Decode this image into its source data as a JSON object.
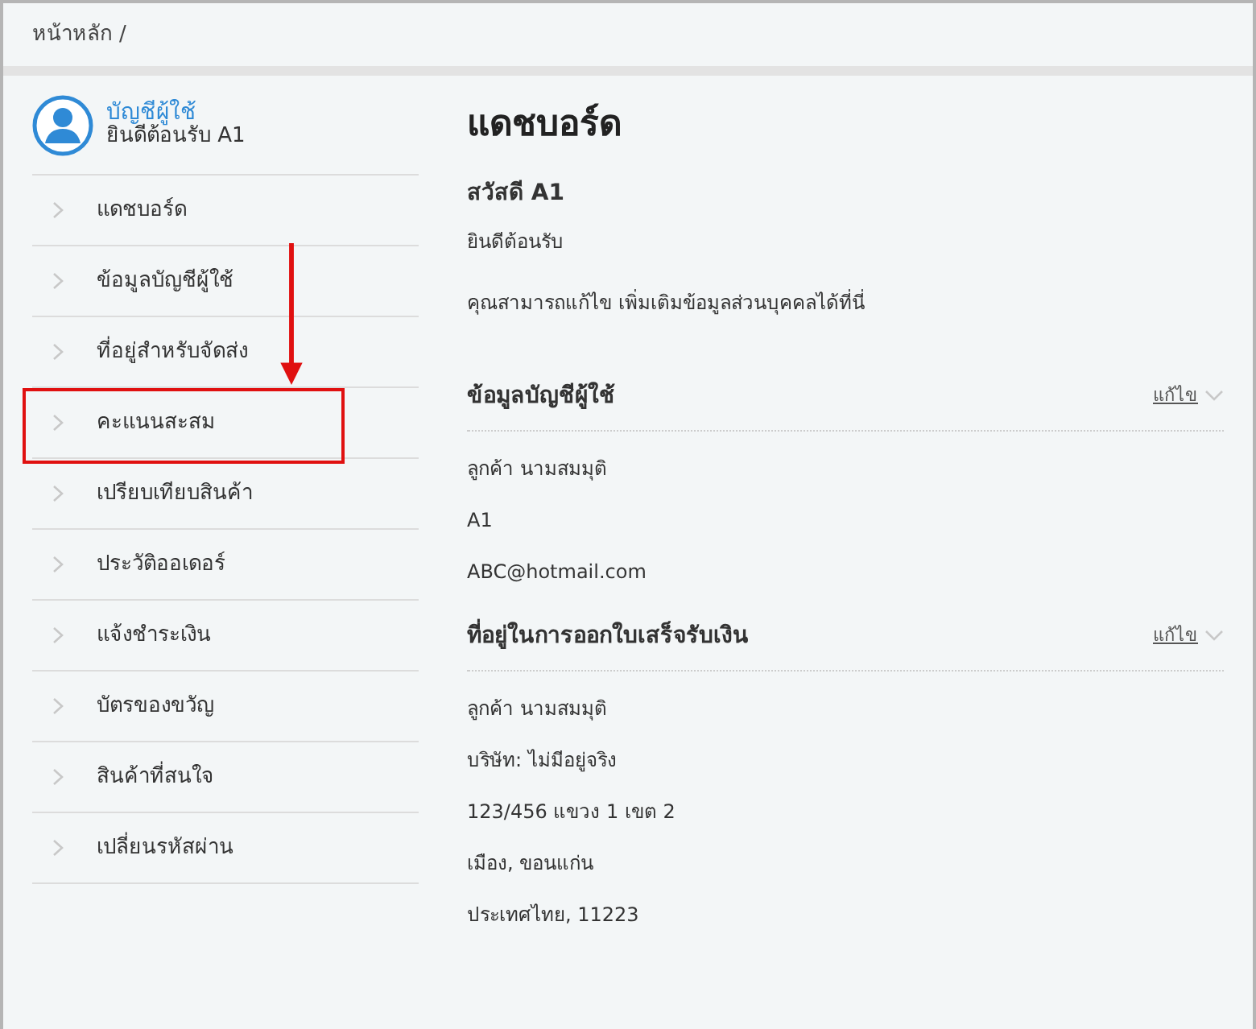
{
  "breadcrumb": {
    "items": [
      "หน้าหลัก"
    ],
    "separator": "/"
  },
  "account": {
    "title": "บัญชีผู้ใช้",
    "subtitle": "ยินดีต้อนรับ A1"
  },
  "sidebar": {
    "items": [
      {
        "label": "แดชบอร์ด",
        "highlighted": false
      },
      {
        "label": "ข้อมูลบัญชีผู้ใช้",
        "highlighted": false
      },
      {
        "label": "ที่อยู่สำหรับจัดส่ง",
        "highlighted": false
      },
      {
        "label": "คะแนนสะสม",
        "highlighted": true
      },
      {
        "label": "เปรียบเทียบสินค้า",
        "highlighted": false
      },
      {
        "label": "ประวัติออเดอร์",
        "highlighted": false
      },
      {
        "label": "แจ้งชำระเงิน",
        "highlighted": false
      },
      {
        "label": "บัตรของขวัญ",
        "highlighted": false
      },
      {
        "label": "สินค้าที่สนใจ",
        "highlighted": false
      },
      {
        "label": "เปลี่ยนรหัสผ่าน",
        "highlighted": false
      }
    ]
  },
  "main": {
    "title": "แดชบอร์ด",
    "greeting": "สวัสดี A1",
    "welcome": "ยินดีต้อนรับ",
    "note": "คุณสามารถแก้ไข เพิ่มเติมข้อมูลส่วนบุคคลได้ที่นี่",
    "sections": [
      {
        "title": "ข้อมูลบัญชีผู้ใช้",
        "edit": "แก้ไข",
        "lines": [
          "ลูกค้า นามสมมุติ",
          "A1",
          "ABC@hotmail.com"
        ]
      },
      {
        "title": "ที่อยู่ในการออกใบเสร็จรับเงิน",
        "edit": "แก้ไข",
        "lines": [
          "ลูกค้า นามสมมุติ",
          "บริษัท: ไม่มีอยู่จริง",
          "123/456 แขวง 1 เขต 2",
          "เมือง, ขอนแก่น",
          "ประเทศไทย, 11223"
        ]
      }
    ]
  }
}
